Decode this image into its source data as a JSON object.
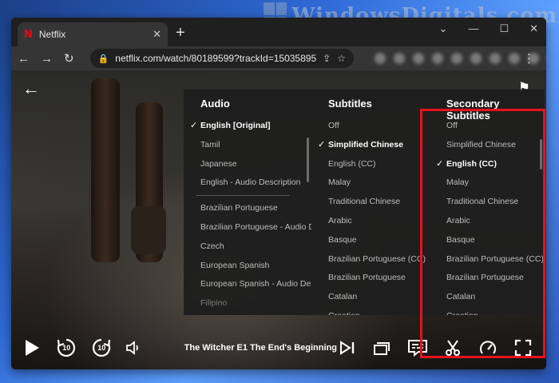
{
  "watermark": {
    "text": "WindowsDigitals.com"
  },
  "browser": {
    "tab_title": "Netflix",
    "tab_favicon": "N",
    "url": "netflix.com/watch/80189599?trackId=15035895"
  },
  "menus": {
    "audio": {
      "title": "Audio",
      "items_primary": [
        "English [Original]",
        "Tamil",
        "Japanese",
        "English - Audio Description"
      ],
      "items_secondary": [
        "Brazilian Portuguese",
        "Brazilian Portuguese - Audio Desc",
        "Czech",
        "European Spanish",
        "European Spanish - Audio Descrip",
        "Filipino"
      ],
      "selected": "English [Original]"
    },
    "subtitles": {
      "title": "Subtitles",
      "items": [
        "Off",
        "Simplified Chinese",
        "English (CC)",
        "Malay",
        "Traditional Chinese",
        "Arabic",
        "Basque",
        "Brazilian Portuguese (CC)",
        "Brazilian Portuguese",
        "Catalan",
        "Croatian"
      ],
      "selected": "Simplified Chinese"
    },
    "secondary_subtitles": {
      "title": "Secondary Subtitles",
      "items": [
        "Off",
        "Simplified Chinese",
        "English (CC)",
        "Malay",
        "Traditional Chinese",
        "Arabic",
        "Basque",
        "Brazilian Portuguese (CC)",
        "Brazilian Portuguese",
        "Catalan",
        "Croatian"
      ],
      "selected": "English (CC)"
    }
  },
  "player": {
    "episode_title": "The Witcher E1  The End's Beginning",
    "skip_back": "10",
    "skip_forward": "10"
  },
  "icons": {
    "back": "arrow-left-icon",
    "flag": "flag-icon",
    "play": "play-icon",
    "rewind": "rewind-10-icon",
    "forward": "forward-10-icon",
    "volume": "volume-icon",
    "next_episode": "next-episode-icon",
    "episodes": "episodes-icon",
    "subtitles": "subtitles-icon",
    "clip": "scissors-icon",
    "speed": "speed-icon",
    "fullscreen": "fullscreen-icon"
  },
  "colors": {
    "highlight": "#e8121b",
    "netflix_red": "#e50914"
  }
}
